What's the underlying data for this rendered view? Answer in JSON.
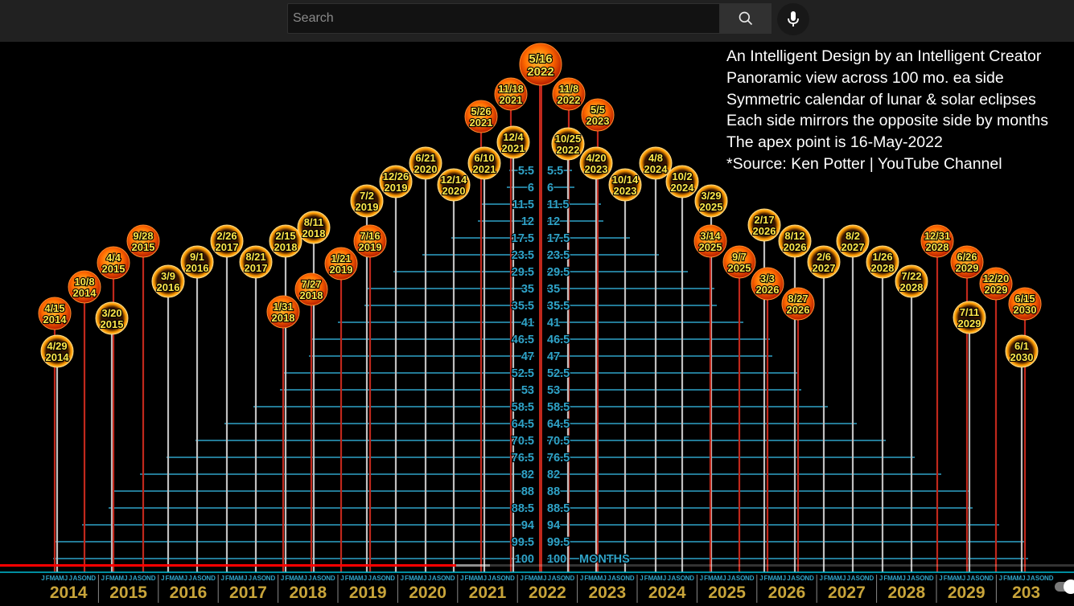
{
  "search": {
    "placeholder": "Search"
  },
  "icons": {
    "search": "search-icon",
    "mic": "mic-icon"
  },
  "colors": {
    "topbar": "#212121",
    "line": "#2fa3c8",
    "redline": "#c0281c",
    "greyline": "#bfbfbf",
    "year": "#c8a43a",
    "label": "#ffe84a"
  },
  "caption": [
    "An Intelligent Design by an Intelligent Creator",
    "Panoramic view across 100 mo. ea side",
    "Symmetric calendar of lunar & solar eclipses",
    "Each side mirrors the opposite side by months",
    "The apex point is 16-May-2022",
    "*Source: Ken Potter | YouTube Channel"
  ],
  "progress": {
    "played_fraction": 0.425,
    "loaded_fraction": 0.456
  },
  "chart_data": {
    "type": "diagram",
    "apex": {
      "date": "5/16",
      "year": "2022"
    },
    "months_label": "MONTHS",
    "month_letters": "JFMAMJJASOND",
    "timeline_years": [
      "2014",
      "2015",
      "2016",
      "2017",
      "2018",
      "2019",
      "2020",
      "2021",
      "2022",
      "2023",
      "2024",
      "2025",
      "2026",
      "2027",
      "2028",
      "2029",
      "2030"
    ],
    "timeline_last_label": "203",
    "left_offsets": [
      "5.5",
      "6",
      "11.5",
      "12",
      "17.5",
      "23.5",
      "29.5",
      "35",
      "35.5",
      "41",
      "46.5",
      "47",
      "52.5",
      "53",
      "58.5",
      "64.5",
      "70.5",
      "76.5",
      "82",
      "88",
      "88.5",
      "94",
      "99.5",
      "100"
    ],
    "right_offsets": [
      "5.5",
      "6",
      "11.5",
      "12",
      "17.5",
      "23.5",
      "29.5",
      "35",
      "35.5",
      "41",
      "46.5",
      "47",
      "52.5",
      "53",
      "58.5",
      "64.5",
      "70.5",
      "76.5",
      "82",
      "88",
      "88.5",
      "94",
      "99.5",
      "100"
    ],
    "eclipses": [
      {
        "date": "4/15",
        "year": "2014",
        "kind": "lunar"
      },
      {
        "date": "4/29",
        "year": "2014",
        "kind": "solar"
      },
      {
        "date": "10/8",
        "year": "2014",
        "kind": "lunar"
      },
      {
        "date": "3/20",
        "year": "2015",
        "kind": "solar"
      },
      {
        "date": "4/4",
        "year": "2015",
        "kind": "lunar"
      },
      {
        "date": "9/28",
        "year": "2015",
        "kind": "lunar"
      },
      {
        "date": "3/9",
        "year": "2016",
        "kind": "solar"
      },
      {
        "date": "9/1",
        "year": "2016",
        "kind": "solar"
      },
      {
        "date": "2/26",
        "year": "2017",
        "kind": "solar"
      },
      {
        "date": "8/21",
        "year": "2017",
        "kind": "solar"
      },
      {
        "date": "1/31",
        "year": "2018",
        "kind": "lunar"
      },
      {
        "date": "2/15",
        "year": "2018",
        "kind": "solar"
      },
      {
        "date": "7/27",
        "year": "2018",
        "kind": "lunar"
      },
      {
        "date": "8/11",
        "year": "2018",
        "kind": "solar"
      },
      {
        "date": "1/21",
        "year": "2019",
        "kind": "lunar"
      },
      {
        "date": "7/2",
        "year": "2019",
        "kind": "solar"
      },
      {
        "date": "7/16",
        "year": "2019",
        "kind": "lunar"
      },
      {
        "date": "12/26",
        "year": "2019",
        "kind": "solar"
      },
      {
        "date": "6/21",
        "year": "2020",
        "kind": "solar"
      },
      {
        "date": "12/14",
        "year": "2020",
        "kind": "solar"
      },
      {
        "date": "5/26",
        "year": "2021",
        "kind": "lunar"
      },
      {
        "date": "6/10",
        "year": "2021",
        "kind": "solar"
      },
      {
        "date": "11/18",
        "year": "2021",
        "kind": "lunar"
      },
      {
        "date": "12/4",
        "year": "2021",
        "kind": "solar"
      },
      {
        "date": "11/8",
        "year": "2022",
        "kind": "lunar"
      },
      {
        "date": "10/25",
        "year": "2022",
        "kind": "solar"
      },
      {
        "date": "5/5",
        "year": "2023",
        "kind": "lunar"
      },
      {
        "date": "4/20",
        "year": "2023",
        "kind": "solar"
      },
      {
        "date": "10/14",
        "year": "2023",
        "kind": "solar"
      },
      {
        "date": "4/8",
        "year": "2024",
        "kind": "solar"
      },
      {
        "date": "10/2",
        "year": "2024",
        "kind": "solar"
      },
      {
        "date": "3/29",
        "year": "2025",
        "kind": "solar"
      },
      {
        "date": "3/14",
        "year": "2025",
        "kind": "lunar"
      },
      {
        "date": "9/7",
        "year": "2025",
        "kind": "lunar"
      },
      {
        "date": "2/17",
        "year": "2026",
        "kind": "solar"
      },
      {
        "date": "3/3",
        "year": "2026",
        "kind": "lunar"
      },
      {
        "date": "8/12",
        "year": "2026",
        "kind": "solar"
      },
      {
        "date": "8/27",
        "year": "2026",
        "kind": "lunar"
      },
      {
        "date": "2/6",
        "year": "2027",
        "kind": "solar"
      },
      {
        "date": "8/2",
        "year": "2027",
        "kind": "solar"
      },
      {
        "date": "1/26",
        "year": "2028",
        "kind": "solar"
      },
      {
        "date": "7/22",
        "year": "2028",
        "kind": "solar"
      },
      {
        "date": "12/31",
        "year": "2028",
        "kind": "lunar"
      },
      {
        "date": "6/26",
        "year": "2029",
        "kind": "lunar"
      },
      {
        "date": "7/11",
        "year": "2029",
        "kind": "solar"
      },
      {
        "date": "12/20",
        "year": "2029",
        "kind": "lunar"
      },
      {
        "date": "6/15",
        "year": "2030",
        "kind": "lunar"
      },
      {
        "date": "6/1",
        "year": "2030",
        "kind": "solar"
      }
    ]
  }
}
